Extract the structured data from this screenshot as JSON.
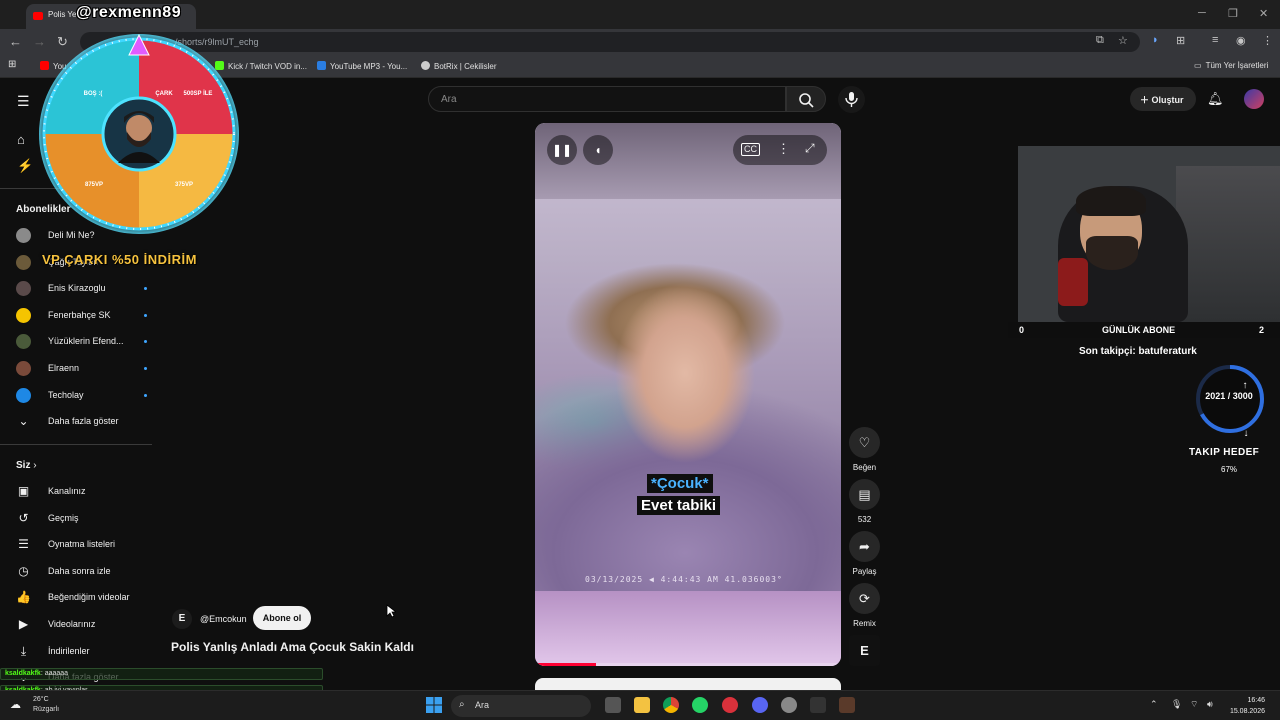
{
  "browser": {
    "tab_title": "Polis Yer",
    "url": "/shorts/r9lmUT_echg",
    "bookmarks": [
      {
        "label": "You",
        "color": "#ff0000"
      },
      {
        "label": "Kick / Twitch VOD in...",
        "color": "#53fc18"
      },
      {
        "label": "YouTube MP3 - You...",
        "color": "#2a7de1"
      },
      {
        "label": "BotRix | Cekilisler",
        "color": "#cccccc"
      }
    ],
    "all_bookmarks": "Tüm Yer İşaretleri"
  },
  "youtube": {
    "search_placeholder": "Ara",
    "create_label": "Oluştur",
    "subscriptions_heading": "Abonelikler",
    "subscriptions": [
      {
        "label": "Deli Mi Ne?",
        "color": "#8a8a8a",
        "live": false
      },
      {
        "label": "Çağrı Taylan",
        "color": "#6b5a3a",
        "live": false
      },
      {
        "label": "Enis Kirazoglu",
        "color": "#5a4a4a",
        "live": true
      },
      {
        "label": "Fenerbahçe SK",
        "color": "#f5c400",
        "live": true
      },
      {
        "label": "Yüzüklerin Efend...",
        "color": "#4a5a3a",
        "live": true
      },
      {
        "label": "Elraenn",
        "color": "#7a4a3a",
        "live": true
      },
      {
        "label": "Techolay",
        "color": "#1e88e5",
        "live": true
      }
    ],
    "show_more": "Daha fazla göster",
    "you_heading": "Siz",
    "you_items": [
      {
        "label": "Kanalınız",
        "icon": "channel-icon",
        "glyph": "▣"
      },
      {
        "label": "Geçmiş",
        "icon": "history-icon",
        "glyph": "↺"
      },
      {
        "label": "Oynatma listeleri",
        "icon": "playlist-icon",
        "glyph": "☰"
      },
      {
        "label": "Daha sonra izle",
        "icon": "clock-icon",
        "glyph": "◷"
      },
      {
        "label": "Beğendiğim videolar",
        "icon": "thumbs-up-icon",
        "glyph": "👍"
      },
      {
        "label": "Videolarınız",
        "icon": "video-icon",
        "glyph": "▶"
      },
      {
        "label": "İndirilenler",
        "icon": "download-icon",
        "glyph": "⤓"
      }
    ],
    "you_show_more": "Daha fazla göster",
    "short": {
      "caption_line1": "*Çocuk*",
      "caption_line2": "Evet tabiki",
      "timestamp": "03/13/2025 ◀ 4:44:43 AM 41.036003°",
      "progress": 0.2,
      "like_label": "Beğen",
      "comments_count": "532",
      "share_label": "Paylaş",
      "remix_label": "Remix",
      "channel_initial": "E",
      "channel_handle": "@Emcokun",
      "subscribe_label": "Abone ol",
      "title": "Polis Yanlış Anladı Ama Çocuk Sakin Kaldı"
    }
  },
  "overlay": {
    "streamer_name": "@rexmenn89",
    "wheel_segments": [
      "BOŞ :(",
      "ÇARK",
      "500SP İLE",
      "875VP",
      "375VP"
    ],
    "wheel_colors": [
      "#2bc4d6",
      "#e0344a",
      "#e7902a",
      "#f5b942"
    ],
    "promo": "VP ÇARKI %50 İNDİRİM",
    "daily_subs_label": "GÜNLÜK ABONE",
    "daily_subs_left": "0",
    "daily_subs_right": "2",
    "last_follower": "Son takipçi: batuferaturk",
    "goal_value": "2021 / 3000",
    "goal_label": "TAKIP HEDEF",
    "goal_percent": "67%",
    "goal_fraction": 0.67,
    "chat": [
      {
        "user": "ksaldkakfk",
        "text": "aaaaaa"
      },
      {
        "user": "ksaldkakfk",
        "text": "ab iyi yayınlar"
      }
    ]
  },
  "taskbar": {
    "temperature": "26°C",
    "weather": "Rüzgarlı",
    "search_placeholder": "Ara",
    "time": "16:46",
    "date": "15.08.2026"
  }
}
